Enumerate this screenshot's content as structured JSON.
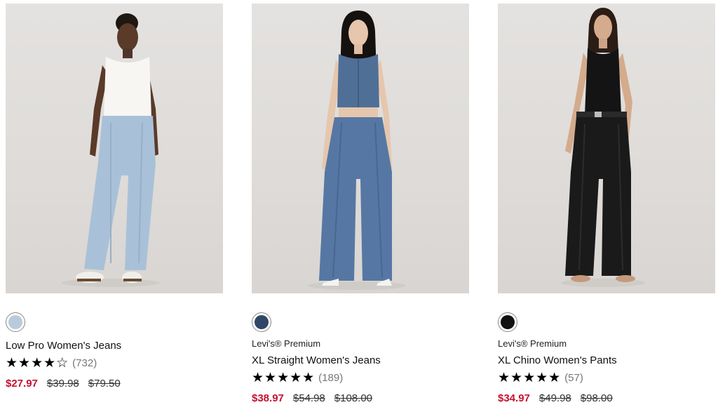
{
  "products": [
    {
      "image_icon": "product-photo-light-wash-jeans",
      "swatch_color": "#b9cbdb",
      "brand": "",
      "name": "Low Pro Women's Jeans",
      "stars": "★★★★☆",
      "rating_value": 4,
      "reviews": "(732)",
      "sale_price": "$27.97",
      "was_prices": [
        "$39.98",
        "$79.50"
      ]
    },
    {
      "image_icon": "product-photo-medium-wash-wide-jeans",
      "swatch_color": "#2f4667",
      "brand": "Levi's® Premium",
      "name": "XL Straight Women's Jeans",
      "stars": "★★★★★",
      "rating_value": 5,
      "reviews": "(189)",
      "sale_price": "$38.97",
      "was_prices": [
        "$54.98",
        "$108.00"
      ]
    },
    {
      "image_icon": "product-photo-black-chino-pants",
      "swatch_color": "#111111",
      "brand": "Levi's® Premium",
      "name": "XL Chino Women's Pants",
      "stars": "★★★★★",
      "rating_value": 5,
      "reviews": "(57)",
      "sale_price": "$34.97",
      "was_prices": [
        "$49.98",
        "$98.00"
      ]
    }
  ],
  "colors": {
    "sale": "#c41230",
    "strikethrough": "#333333",
    "review_count": "#777777"
  }
}
